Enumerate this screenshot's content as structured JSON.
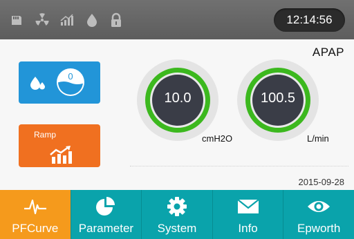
{
  "status_bar": {
    "icons": [
      "sd-card-icon",
      "radiation-icon",
      "signal-icon",
      "water-drop-icon",
      "lock-icon"
    ],
    "time": "12:14:56"
  },
  "main": {
    "mode": "APAP",
    "humidifier": {
      "level": "0"
    },
    "ramp": {
      "label": "Ramp"
    },
    "pressure": {
      "value": "10.0",
      "unit": "cmH2O"
    },
    "flow": {
      "value": "100.5",
      "unit": "L/min"
    },
    "date": "2015-09-28"
  },
  "tabs": [
    {
      "label": "PFCurve",
      "icon": "waveform-icon",
      "active": true
    },
    {
      "label": "Parameter",
      "icon": "pie-chart-icon",
      "active": false
    },
    {
      "label": "System",
      "icon": "gear-icon",
      "active": false
    },
    {
      "label": "Info",
      "icon": "envelope-icon",
      "active": false
    },
    {
      "label": "Epworth",
      "icon": "eye-icon",
      "active": false
    }
  ],
  "colors": {
    "status_bar": "#666666",
    "humidifier_button": "#2295d8",
    "ramp_button": "#f07020",
    "gauge_ring": "#3cb81e",
    "tab_bar": "#0aa3ab",
    "tab_active": "#f59a1c"
  }
}
